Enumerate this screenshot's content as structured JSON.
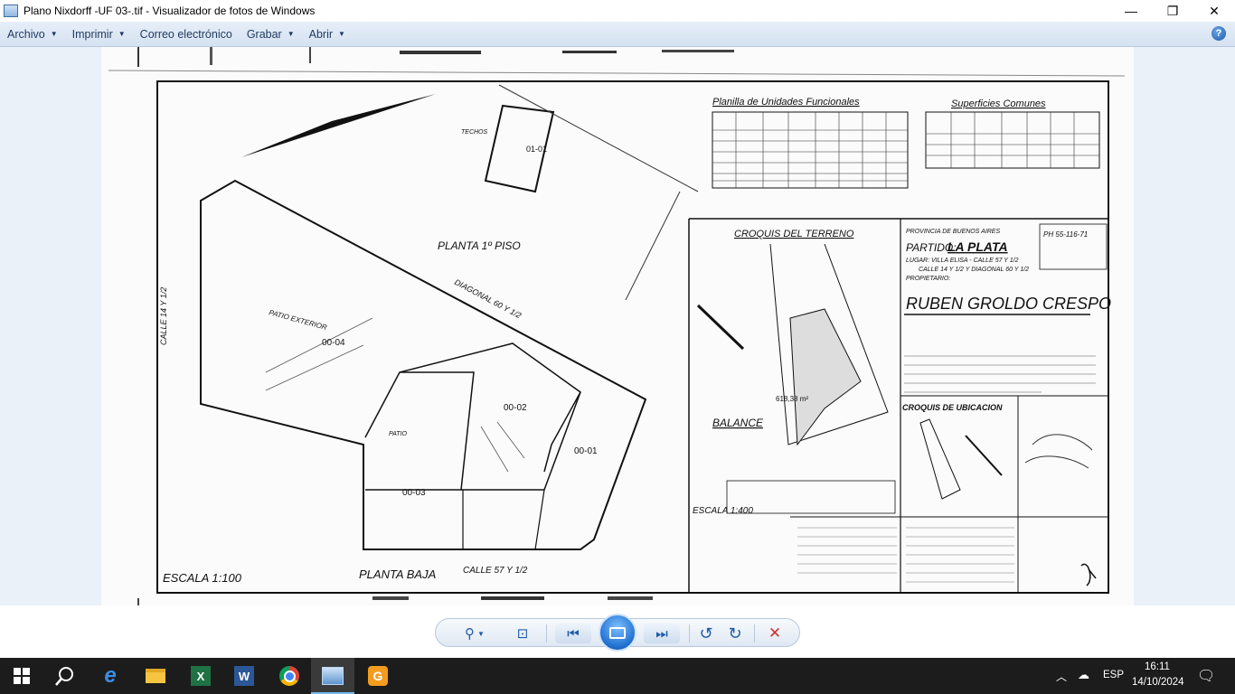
{
  "window": {
    "title": "Plano Nixdorff -UF 03-.tif - Visualizador de fotos de Windows",
    "minimize_glyph": "—",
    "restore_glyph": "❐",
    "close_glyph": "✕"
  },
  "menu": {
    "items": [
      {
        "label": "Archivo",
        "has_arrow": true
      },
      {
        "label": "Imprimir",
        "has_arrow": true
      },
      {
        "label": "Correo electrónico",
        "has_arrow": false
      },
      {
        "label": "Grabar",
        "has_arrow": true
      },
      {
        "label": "Abrir",
        "has_arrow": true
      }
    ],
    "help_glyph": "?"
  },
  "plan": {
    "table1_title": "Planilla de Unidades Funcionales",
    "table2_title": "Superficies Comunes",
    "planta_piso": "PLANTA 1º PISO",
    "planta_baja": "PLANTA BAJA",
    "escala_main": "ESCALA 1:100",
    "calle_14": "CALLE 14 Y 1/2",
    "calle_57": "CALLE 57 Y 1/2",
    "diagonal_60": "DIAGONAL 60 Y 1/2",
    "patio_exterior": "PATIO EXTERIOR",
    "uf_04": "00-04",
    "uf_02": "00-02",
    "uf_01": "00-01",
    "uf_03": "00-03",
    "uf_101": "01-01",
    "patio": "PATIO",
    "techos": "TECHOS",
    "croquis": "CROQUIS DEL TERRENO",
    "balance": "BALANCE",
    "escala_croquis": "ESCALA 1:400",
    "provincia": "PROVINCIA DE BUENOS AIRES",
    "partido_label": "PARTIDO:",
    "partido_value": "LA PLATA",
    "lugar": "LUGAR: VILLA ELISA - CALLE 57 Y 1/2",
    "lugar2": "CALLE 14 Y 1/2 Y DIAGONAL 60 Y 1/2",
    "propietario_label": "PROPIETARIO:",
    "owner": "RUBEN GROLDO CRESPO",
    "ubicacion": "CROQUIS DE UBICACION",
    "plano_num": "PH 55-116-71"
  },
  "toolbar": {
    "zoom_glyph": "⚲",
    "fit_glyph": "⊡",
    "prev_glyph": "⏮",
    "next_glyph": "⏭",
    "rotate_left_glyph": "↺",
    "rotate_right_glyph": "↻",
    "delete_glyph": "✕"
  },
  "taskbar": {
    "lang": "ESP",
    "time": "16:11",
    "date": "14/10/2024"
  }
}
